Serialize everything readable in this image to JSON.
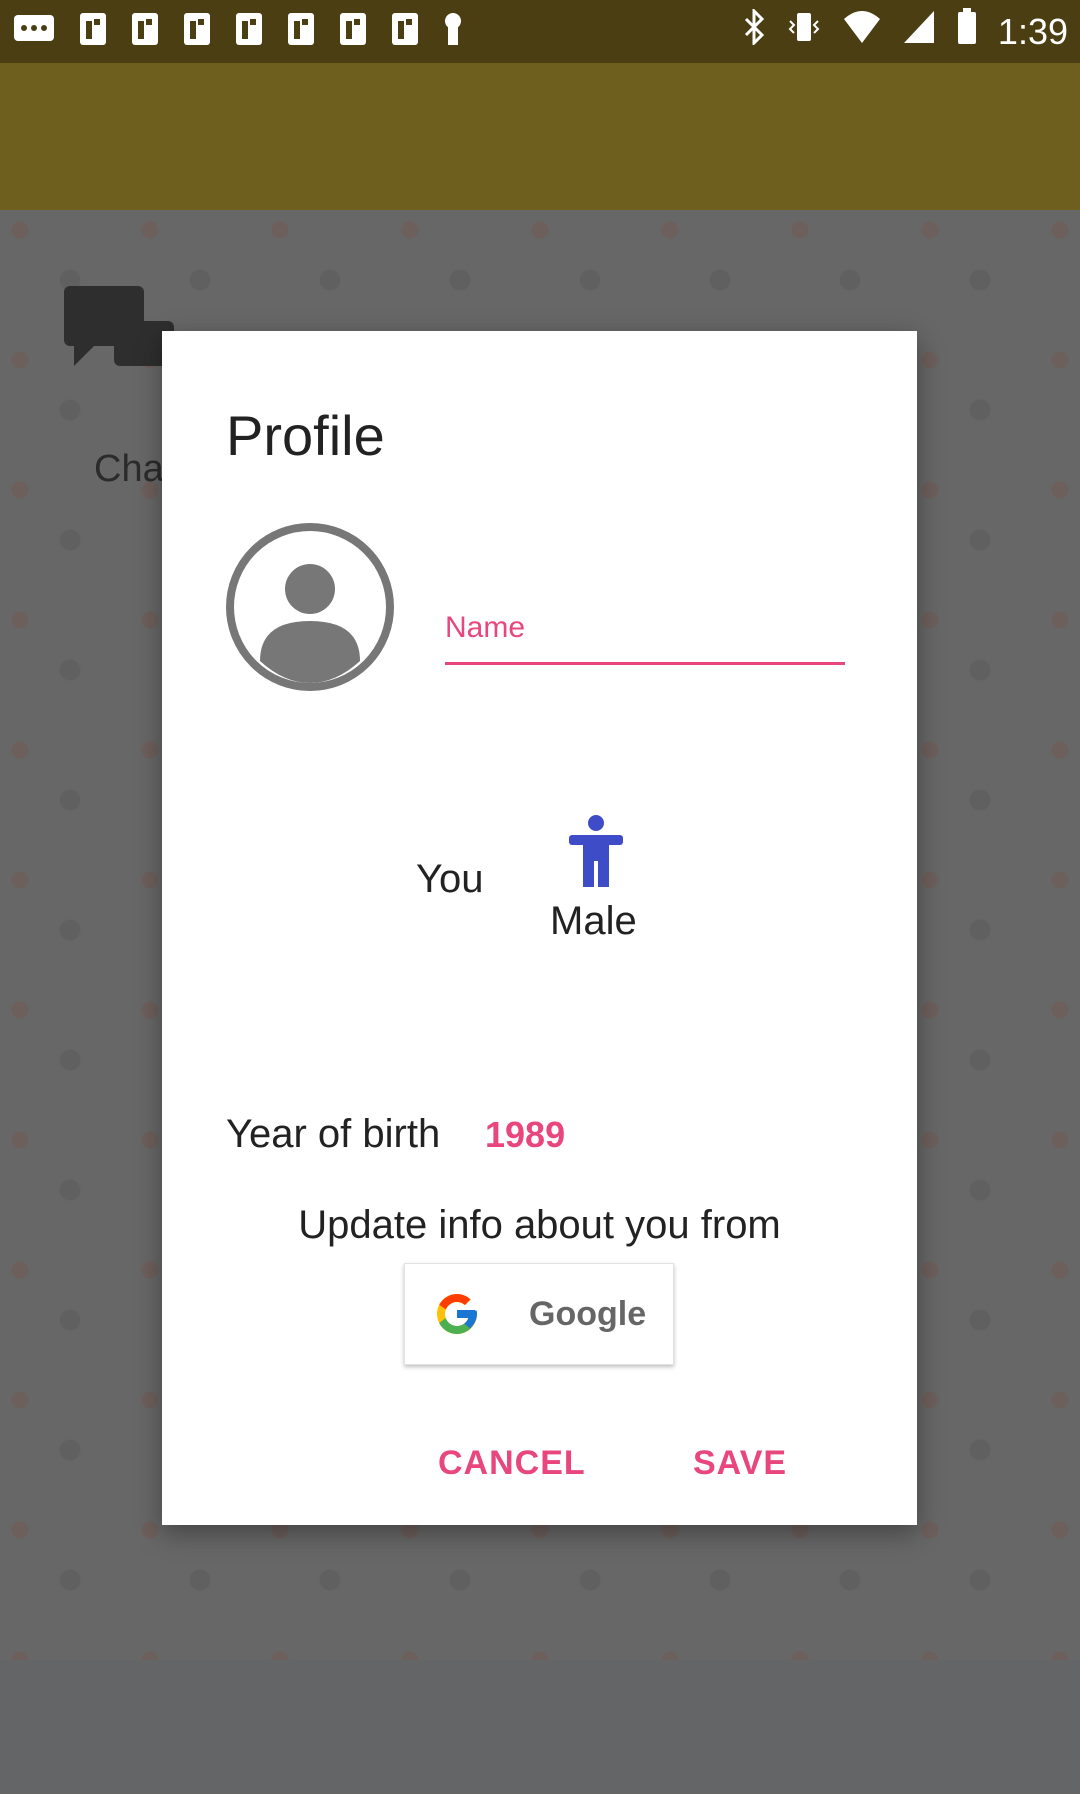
{
  "status_bar": {
    "time": "1:39",
    "icons": [
      "message-icon",
      "notification-icon",
      "notification-icon",
      "notification-icon",
      "notification-icon",
      "notification-icon",
      "notification-icon",
      "notification-icon",
      "lock-icon",
      "bluetooth-icon",
      "vibrate-icon",
      "wifi-icon",
      "signal-icon",
      "battery-icon"
    ]
  },
  "background": {
    "chat_label": "Cha"
  },
  "dialog": {
    "title": "Profile",
    "name_placeholder": "Name",
    "gender": {
      "you_label": "You",
      "value": "Male",
      "icon": "male-person-icon"
    },
    "birth": {
      "label": "Year of birth",
      "value": "1989"
    },
    "update_text": "Update info about you from",
    "google_button_label": "Google",
    "cancel_label": "CANCEL",
    "save_label": "SAVE"
  },
  "colors": {
    "accent": "#e8467c",
    "gender_icon": "#3f4cc7",
    "status_bar": "#4a3e12",
    "app_bar": "#6f5f1e"
  }
}
